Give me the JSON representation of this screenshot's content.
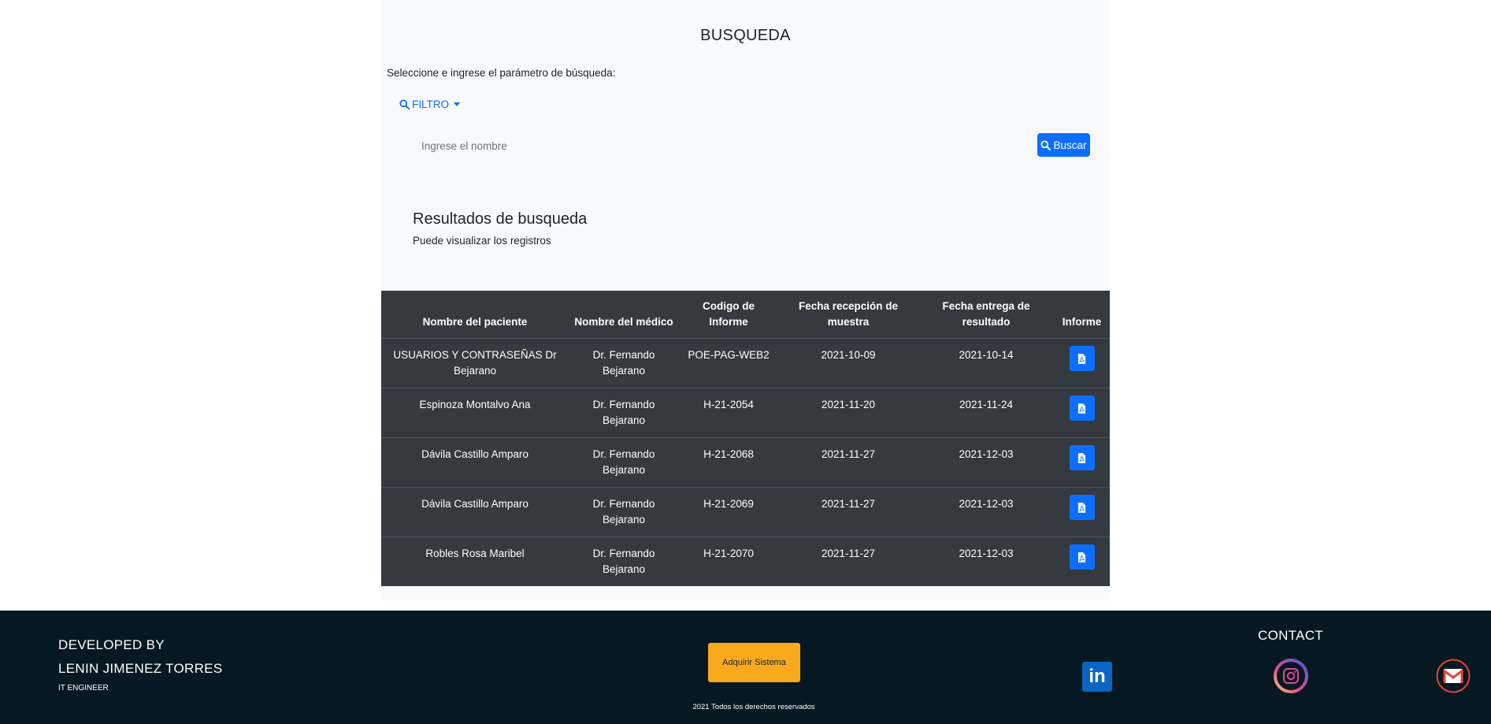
{
  "search": {
    "title": "BUSQUEDA",
    "instruction": "Seleccione e ingrese el parámetro de búsqueda:",
    "filter_label": "FILTRO",
    "input_placeholder": "Ingrese el nombre",
    "button_label": "Buscar"
  },
  "results": {
    "title": "Resultados de busqueda",
    "subtitle": "Puede visualizar los registros",
    "columns": [
      "Nombre del paciente",
      "Nombre del médico",
      "Codigo de Informe",
      "Fecha recepción de muestra",
      "Fecha entrega de resultado",
      "Informe"
    ],
    "rows": [
      {
        "patient": "USUARIOS Y CONTRASEÑAS Dr Bejarano",
        "doctor": "Dr. Fernando Bejarano",
        "code": "POE-PAG-WEB2",
        "received": "2021-10-09",
        "delivered": "2021-10-14"
      },
      {
        "patient": "Espinoza Montalvo Ana",
        "doctor": "Dr. Fernando Bejarano",
        "code": "H-21-2054",
        "received": "2021-11-20",
        "delivered": "2021-11-24"
      },
      {
        "patient": "Dávila Castillo Amparo",
        "doctor": "Dr. Fernando Bejarano",
        "code": "H-21-2068",
        "received": "2021-11-27",
        "delivered": "2021-12-03"
      },
      {
        "patient": "Dávila Castillo Amparo",
        "doctor": "Dr. Fernando Bejarano",
        "code": "H-21-2069",
        "received": "2021-11-27",
        "delivered": "2021-12-03"
      },
      {
        "patient": "Robles Rosa Maribel",
        "doctor": "Dr. Fernando Bejarano",
        "code": "H-21-2070",
        "received": "2021-11-27",
        "delivered": "2021-12-03"
      }
    ]
  },
  "footer": {
    "developed_by": "DEVELOPED BY",
    "developer_name": "LENIN JIMENEZ TORRES",
    "developer_role": "IT ENGINEER",
    "acquire_button": "Adquirir Sistema",
    "rights": "2021 Todos los derechos reservados",
    "contact_title": "CONTACT",
    "icons": [
      "linkedin-icon",
      "instagram-icon",
      "gmail-icon"
    ]
  },
  "colors": {
    "primary": "#0d6efd",
    "table_bg": "#343a40",
    "footer_bg": "#061922",
    "acquire_button": "#f8a91c",
    "panel_bg": "#f8f9fa"
  }
}
